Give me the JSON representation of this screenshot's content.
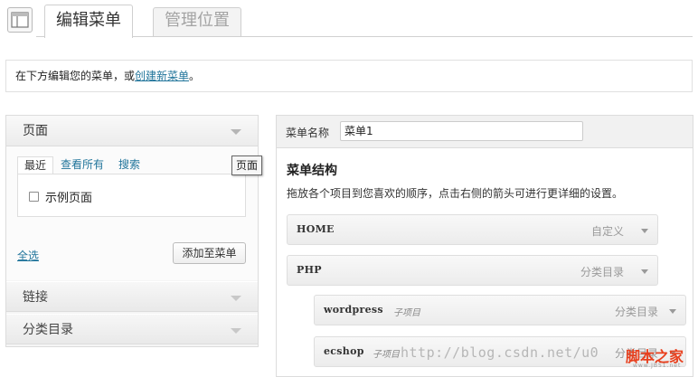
{
  "top_tabs": {
    "active": "编辑菜单",
    "inactive": "管理位置"
  },
  "notice": {
    "prefix": "在下方编辑您的菜单，或",
    "link": "创建新菜单",
    "suffix": "。"
  },
  "left_panel": {
    "pages_header": "页面",
    "subtabs": [
      "最近",
      "查看所有",
      "搜索"
    ],
    "page_option": "示例页面",
    "select_all": "全选",
    "add_button": "添加至菜单",
    "links_header": "链接",
    "categories_header": "分类目录"
  },
  "tooltip": "页面",
  "right_panel": {
    "menu_name_label": "菜单名称",
    "menu_name_value": "菜单1",
    "structure_title": "菜单结构",
    "structure_desc": "拖放各个项目到您喜欢的顺序，点击右侧的箭头可进行更详细的设置。",
    "items": [
      {
        "title": "HOME",
        "sub": "",
        "type": "自定义"
      },
      {
        "title": "PHP",
        "sub": "",
        "type": "分类目录"
      },
      {
        "title": "wordpress",
        "sub": "子项目",
        "type": "分类目录"
      },
      {
        "title": "ecshop",
        "sub": "子项目",
        "type": "分类目录"
      }
    ]
  },
  "watermark": {
    "url": "http://blog.csdn.net/u0",
    "logo": "脚本之家",
    "logo_url": "www.JB51.net"
  }
}
